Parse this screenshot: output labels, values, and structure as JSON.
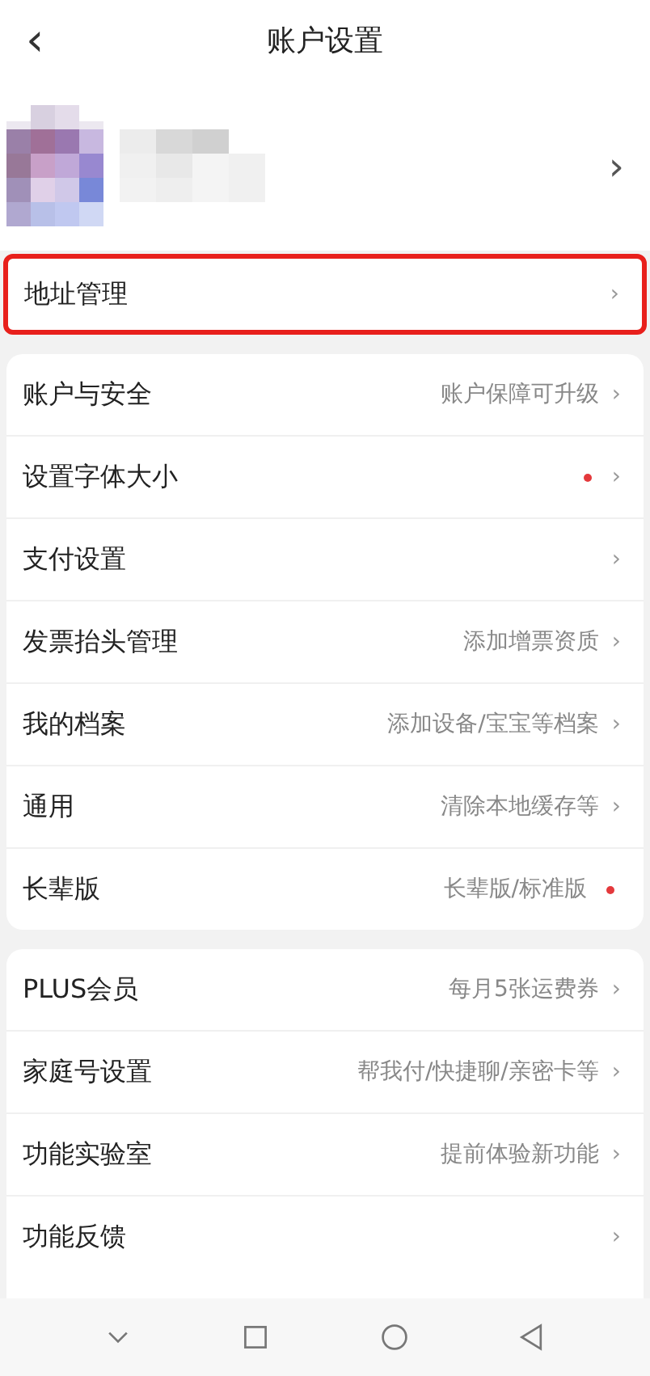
{
  "header": {
    "back": "‹",
    "title": "账户设置"
  },
  "profile": {
    "chevron": "›"
  },
  "groups": [
    {
      "highlighted": true,
      "items": [
        {
          "label": "地址管理",
          "dot": false,
          "chevron": "›"
        }
      ]
    },
    {
      "highlighted": false,
      "items": [
        {
          "label": "账户与安全",
          "value": "账户保障可升级",
          "dot": false,
          "chevron": "›"
        },
        {
          "label": "设置字体大小",
          "dot": true,
          "chevron": "›"
        },
        {
          "label": "支付设置",
          "dot": false,
          "chevron": "›"
        },
        {
          "label": "发票抬头管理",
          "value": "添加增票资质",
          "dot": false,
          "chevron": "›"
        },
        {
          "label": "我的档案",
          "value": "添加设备/宝宝等档案",
          "dot": false,
          "chevron": "›"
        },
        {
          "label": "通用",
          "value": "清除本地缓存等",
          "dot": false,
          "chevron": "›"
        },
        {
          "label": "长辈版",
          "value": "长辈版/标准版",
          "dot": true
        }
      ]
    },
    {
      "highlighted": false,
      "items": [
        {
          "label": "PLUS会员",
          "value": "每月5张运费券",
          "dot": false,
          "chevron": "›"
        },
        {
          "label": "家庭号设置",
          "value": "帮我付/快捷聊/亲密卡等",
          "dot": false,
          "chevron": "›"
        },
        {
          "label": "功能实验室",
          "value": "提前体验新功能",
          "dot": false,
          "chevron": "›"
        },
        {
          "label": "功能反馈",
          "dot": false,
          "chevron": "›"
        }
      ]
    }
  ]
}
